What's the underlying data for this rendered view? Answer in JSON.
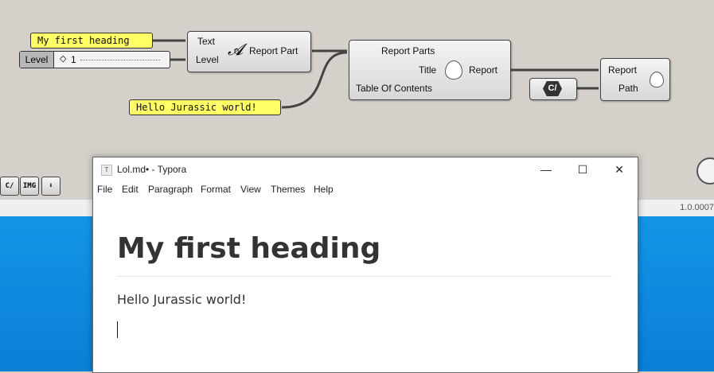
{
  "grasshopper": {
    "panel_heading": "My first heading",
    "panel_text": "Hello Jurassic world!",
    "slider_label": "Level",
    "slider_value": "1",
    "report_part": {
      "in_text": "Text",
      "in_level": "Level",
      "out": "Report Part"
    },
    "report": {
      "in_parts": "Report Parts",
      "in_title": "Title",
      "in_toc": "Table Of Contents",
      "out": "Report"
    },
    "writer": {
      "in_report": "Report",
      "in_path": "Path"
    },
    "path_glyph": "C/",
    "toolbar": {
      "b1": "C/",
      "b2": "IMG",
      "b3": "⬇"
    },
    "version": "1.0.0007"
  },
  "window": {
    "title": "Lol.md• - Typora",
    "icon_letter": "T",
    "minimize": "—",
    "maximize": "☐",
    "close": "✕",
    "menus": [
      "File",
      "Edit",
      "Paragraph",
      "Format",
      "View",
      "Themes",
      "Help"
    ]
  },
  "document": {
    "heading": "My first heading",
    "paragraph": "Hello Jurassic world!"
  }
}
